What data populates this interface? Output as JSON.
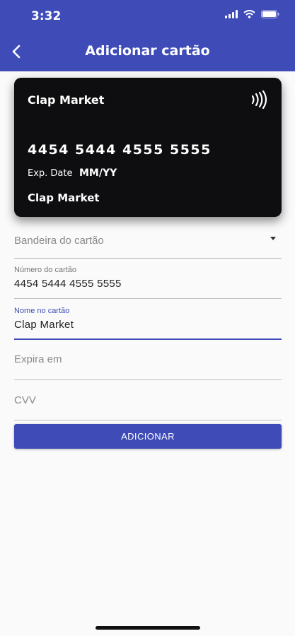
{
  "status_bar": {
    "time": "3:32",
    "icons": [
      "signal-icon",
      "wifi-icon",
      "battery-icon"
    ]
  },
  "header": {
    "title": "Adicionar cartão",
    "back_icon": "chevron-left-icon"
  },
  "card_preview": {
    "brand": "Clap Market",
    "number": "4454 5444 4555 5555",
    "exp_label": "Exp. Date",
    "exp_value": "MM/YY",
    "holder": "Clap Market",
    "contactless_icon": "contactless-icon"
  },
  "form": {
    "card_brand": {
      "placeholder": "Bandeira do cartão"
    },
    "card_number": {
      "label": "Número do cartão",
      "value": "4454 5444 4555 5555"
    },
    "card_name": {
      "label": "Nome no cartão",
      "value": "Clap Market"
    },
    "expiry": {
      "placeholder": "Expira em"
    },
    "cvv": {
      "placeholder": "CVV"
    },
    "submit_label": "ADICIONAR"
  },
  "colors": {
    "primary": "#3f4cb8",
    "card_background": "#0e0e10",
    "page_background": "#fafafa"
  }
}
